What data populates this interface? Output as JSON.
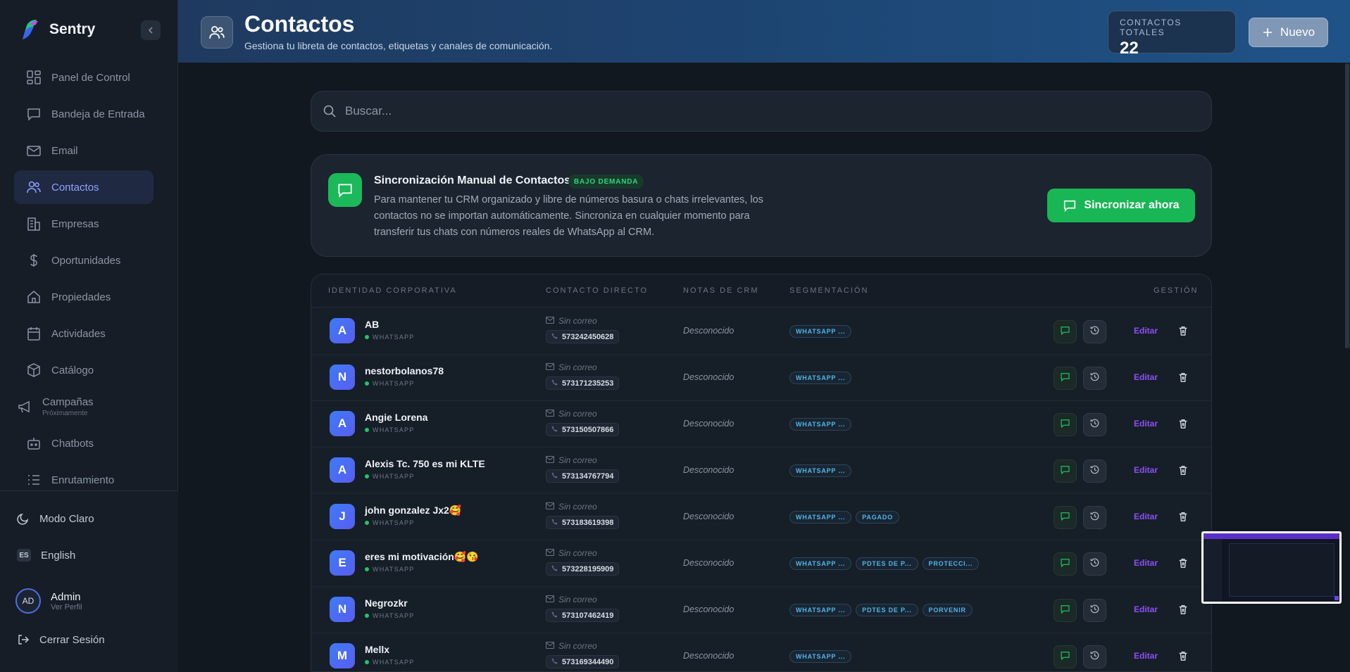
{
  "app": {
    "name": "Sentry"
  },
  "sidebar": {
    "items": [
      {
        "label": "Panel de Control",
        "icon": "dashboard-icon"
      },
      {
        "label": "Bandeja de Entrada",
        "icon": "inbox-icon"
      },
      {
        "label": "Email",
        "icon": "mail-icon"
      },
      {
        "label": "Contactos",
        "icon": "users-icon",
        "active": true
      },
      {
        "label": "Empresas",
        "icon": "building-icon"
      },
      {
        "label": "Oportunidades",
        "icon": "dollar-icon"
      },
      {
        "label": "Propiedades",
        "icon": "home-icon"
      },
      {
        "label": "Actividades",
        "icon": "calendar-icon"
      },
      {
        "label": "Catálogo",
        "icon": "box-icon"
      },
      {
        "label": "Campañas",
        "sub": "Próximamente",
        "icon": "megaphone-icon"
      },
      {
        "label": "Chatbots",
        "icon": "bot-icon"
      },
      {
        "label": "Enrutamiento",
        "icon": "list-icon"
      }
    ],
    "theme_toggle": "Modo Claro",
    "language": {
      "code": "ES",
      "label": "English"
    },
    "user": {
      "initials": "AD",
      "name": "Admin",
      "sub": "Ver Perfil"
    },
    "logout": "Cerrar Sesión"
  },
  "header": {
    "title": "Contactos",
    "subtitle": "Gestiona tu libreta de contactos, etiquetas y canales de comunicación.",
    "total_label": "CONTACTOS TOTALES",
    "total_value": "22",
    "new_button": "Nuevo"
  },
  "search": {
    "placeholder": "Buscar..."
  },
  "sync": {
    "title": "Sincronización Manual de Contactos",
    "badge": "BAJO DEMANDA",
    "description": "Para mantener tu CRM organizado y libre de números basura o chats irrelevantes, los contactos no se importan automáticamente. Sincroniza en cualquier momento para transferir tus chats con números reales de WhatsApp al CRM.",
    "button": "Sincronizar ahora"
  },
  "table": {
    "headers": [
      "IDENTIDAD CORPORATIVA",
      "CONTACTO DIRECTO",
      "NOTAS DE CRM",
      "SEGMENTACIÓN",
      "GESTIÓN"
    ],
    "edit_label": "Editar",
    "rows": [
      {
        "initial": "A",
        "name": "AB",
        "channel": "WHATSAPP",
        "email": "Sin correo",
        "phone": "573242450628",
        "notes": "Desconocido",
        "tags": [
          "WHATSAPP ..."
        ]
      },
      {
        "initial": "N",
        "name": "nestorbolanos78",
        "channel": "WHATSAPP",
        "email": "Sin correo",
        "phone": "573171235253",
        "notes": "Desconocido",
        "tags": [
          "WHATSAPP ..."
        ]
      },
      {
        "initial": "A",
        "name": "Angie Lorena",
        "channel": "WHATSAPP",
        "email": "Sin correo",
        "phone": "573150507866",
        "notes": "Desconocido",
        "tags": [
          "WHATSAPP ..."
        ]
      },
      {
        "initial": "A",
        "name": "Alexis Tc. 750 es mi KLTE",
        "channel": "WHATSAPP",
        "email": "Sin correo",
        "phone": "573134767794",
        "notes": "Desconocido",
        "tags": [
          "WHATSAPP ..."
        ]
      },
      {
        "initial": "J",
        "name": "john gonzalez Jx2🥰",
        "channel": "WHATSAPP",
        "email": "Sin correo",
        "phone": "573183619398",
        "notes": "Desconocido",
        "tags": [
          "WHATSAPP ...",
          "PAGADO"
        ]
      },
      {
        "initial": "E",
        "name": "eres mi motivación🥰😘",
        "channel": "WHATSAPP",
        "email": "Sin correo",
        "phone": "573228195909",
        "notes": "Desconocido",
        "tags": [
          "WHATSAPP ...",
          "PDTES DE P...",
          "PROTECCI..."
        ]
      },
      {
        "initial": "N",
        "name": "Negrozkr",
        "channel": "WHATSAPP",
        "email": "Sin correo",
        "phone": "573107462419",
        "notes": "Desconocido",
        "tags": [
          "WHATSAPP ...",
          "PDTES DE P...",
          "PORVENIR"
        ]
      },
      {
        "initial": "M",
        "name": "Mellx",
        "channel": "WHATSAPP",
        "email": "Sin correo",
        "phone": "573169344490",
        "notes": "Desconocido",
        "tags": [
          "WHATSAPP ..."
        ]
      }
    ]
  }
}
